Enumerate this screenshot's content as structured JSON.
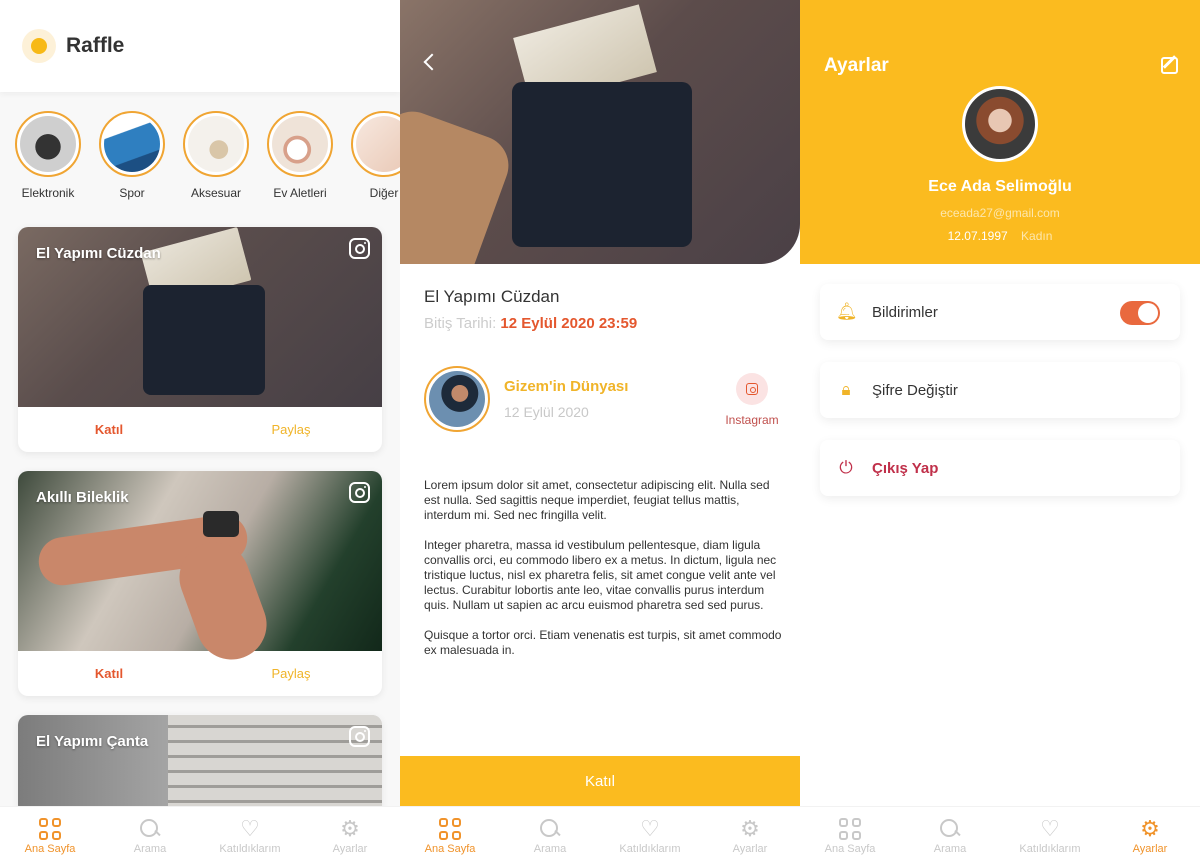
{
  "home": {
    "app_title": "Raffle",
    "categories": [
      {
        "label": "Elektronik"
      },
      {
        "label": "Spor"
      },
      {
        "label": "Aksesuar"
      },
      {
        "label": "Ev Aletleri"
      },
      {
        "label": "Diğer"
      }
    ],
    "cards": [
      {
        "title": "El Yapımı Cüzdan",
        "join": "Katıl",
        "share": "Paylaş"
      },
      {
        "title": "Akıllı Bileklik",
        "join": "Katıl",
        "share": "Paylaş"
      },
      {
        "title": "El Yapımı Çanta"
      }
    ]
  },
  "detail": {
    "title": "El Yapımı Cüzdan",
    "end_label": "Bitiş Tarihi:",
    "end_value": "12 Eylül 2020 23:59",
    "owner_name": "Gizem'in Dünyası",
    "owner_date": "12 Eylül 2020",
    "instagram_label": "Instagram",
    "paragraphs": [
      "Lorem ipsum dolor sit amet, consectetur adipiscing elit. Nulla sed est nulla. Sed sagittis neque imperdiet, feugiat tellus mattis, interdum mi. Sed nec fringilla velit.",
      "Integer pharetra, massa id vestibulum pellentesque, diam ligula convallis orci, eu commodo libero ex a metus. In dictum, ligula nec tristique luctus, nisl ex pharetra felis, sit amet congue velit ante vel lectus. Curabitur lobortis ante leo, vitae convallis purus interdum quis. Nullam ut sapien ac arcu euismod pharetra sed sed purus.",
      "Quisque a tortor orci. Etiam venenatis est turpis, sit amet commodo ex malesuada in."
    ],
    "join_label": "Katıl"
  },
  "settings": {
    "title": "Ayarlar",
    "name": "Ece Ada Selimoğlu",
    "email": "eceada27@gmail.com",
    "birth_date": "12.07.1997",
    "gender": "Kadın",
    "items": [
      {
        "label": "Bildirimler",
        "icon": "bell-icon",
        "toggle_on": true
      },
      {
        "label": "Şifre Değiştir",
        "icon": "lock-icon"
      },
      {
        "label": "Çıkış Yap",
        "icon": "power-icon"
      }
    ]
  },
  "nav": {
    "items": [
      {
        "label": "Ana Sayfa",
        "icon": "grid-icon"
      },
      {
        "label": "Arama",
        "icon": "search-icon"
      },
      {
        "label": "Katıldıklarım",
        "icon": "heart-icon"
      },
      {
        "label": "Ayarlar",
        "icon": "gear-icon"
      }
    ]
  },
  "colors": {
    "accent": "#fbbb1f",
    "orange": "#f0932b",
    "red": "#e4572e",
    "logout": "#c0304a"
  }
}
